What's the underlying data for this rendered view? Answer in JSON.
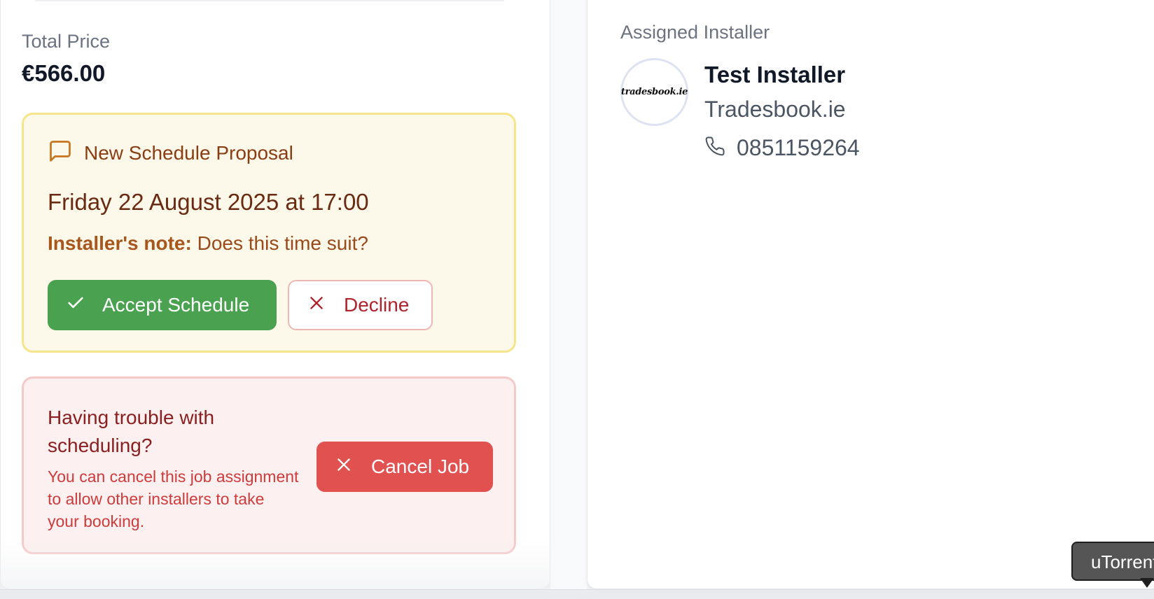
{
  "pricing": {
    "label": "Total Price",
    "value": "€566.00"
  },
  "proposal": {
    "title": "New Schedule Proposal",
    "datetime": "Friday 22 August 2025 at 17:00",
    "note_label": "Installer's note:",
    "note_text": "Does this time suit?",
    "accept_label": "Accept Schedule",
    "decline_label": "Decline"
  },
  "cancel": {
    "title": "Having trouble with scheduling?",
    "body": "You can cancel this job assignment to allow other installers to take your booking.",
    "button_label": "Cancel Job"
  },
  "installer": {
    "section_label": "Assigned Installer",
    "logo_text": "tradesbook.ie",
    "name": "Test Installer",
    "company": "Tradesbook.ie",
    "phone": "0851159264"
  },
  "tooltip": {
    "text": "uTorrent"
  },
  "colors": {
    "accept_green": "#4aa251",
    "cancel_red": "#e05150",
    "proposal_bg": "#fdf9ea",
    "cancel_bg": "#fcf0f0"
  },
  "icons": {
    "proposal": "message-square-icon",
    "accept": "check-icon",
    "decline": "x-icon",
    "cancel": "x-icon",
    "phone": "phone-icon"
  }
}
